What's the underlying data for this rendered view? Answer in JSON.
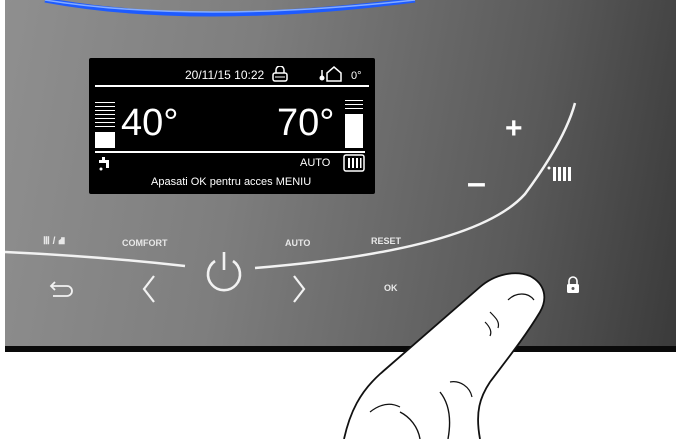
{
  "display": {
    "datetime": "20/11/15 10:22",
    "outdoor_temp": "0°",
    "dhw_temp": "40°",
    "heating_temp": "70°",
    "mode": "AUTO",
    "hint": "Apasati OK pentru acces MENIU"
  },
  "controls": {
    "mode_switch_label": "Ⅲ / ⛘",
    "comfort_label": "COMFORT",
    "auto_label": "AUTO",
    "reset_label": "RESET",
    "ok_label": "OK",
    "plus_label": "+",
    "minus_label": "–"
  },
  "colors": {
    "panel_dark": "#3a3a3a",
    "panel_light": "#8f8f8f",
    "glow_blue": "#1e5bff",
    "lcd_bg": "#000000",
    "text_white": "#ffffff"
  },
  "icons": {
    "back": "back-arrow-icon",
    "left": "chevron-left-icon",
    "power": "power-icon",
    "right": "chevron-right-icon",
    "lock": "lock-icon",
    "radiator": "radiator-icon",
    "tap": "tap-icon",
    "house": "house-icon"
  }
}
